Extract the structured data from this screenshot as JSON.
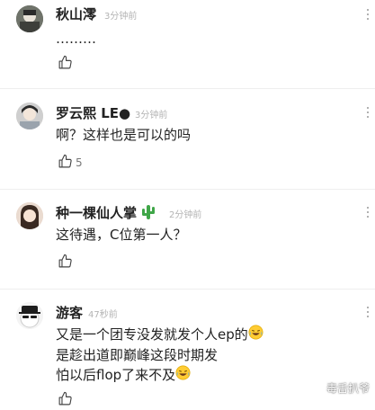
{
  "comments": [
    {
      "username": "秋山澪",
      "time": "3分钟前",
      "lines": [
        "………"
      ],
      "like_count": ""
    },
    {
      "username": "罗云熙 LE●",
      "time": "3分钟前",
      "lines": [
        "啊？这样也是可以的吗"
      ],
      "like_count": "5"
    },
    {
      "username": "种一棵仙人掌",
      "time": "2分钟前",
      "lines": [
        "这待遇，C位第一人？"
      ],
      "like_count": ""
    },
    {
      "username": "游客",
      "time": "47秒前",
      "lines": [
        "又是一个团专没发就发个人ep的",
        "是趁出道即巅峰这段时期发",
        "怕以后flop了来不及"
      ],
      "like_count": ""
    }
  ],
  "watermark": "毒舌扒爷",
  "icons": {
    "like": "thumbs-up-icon",
    "more": "more-vertical-icon",
    "cactus": "cactus-emoji",
    "laugh": "tears-of-joy-emoji"
  }
}
